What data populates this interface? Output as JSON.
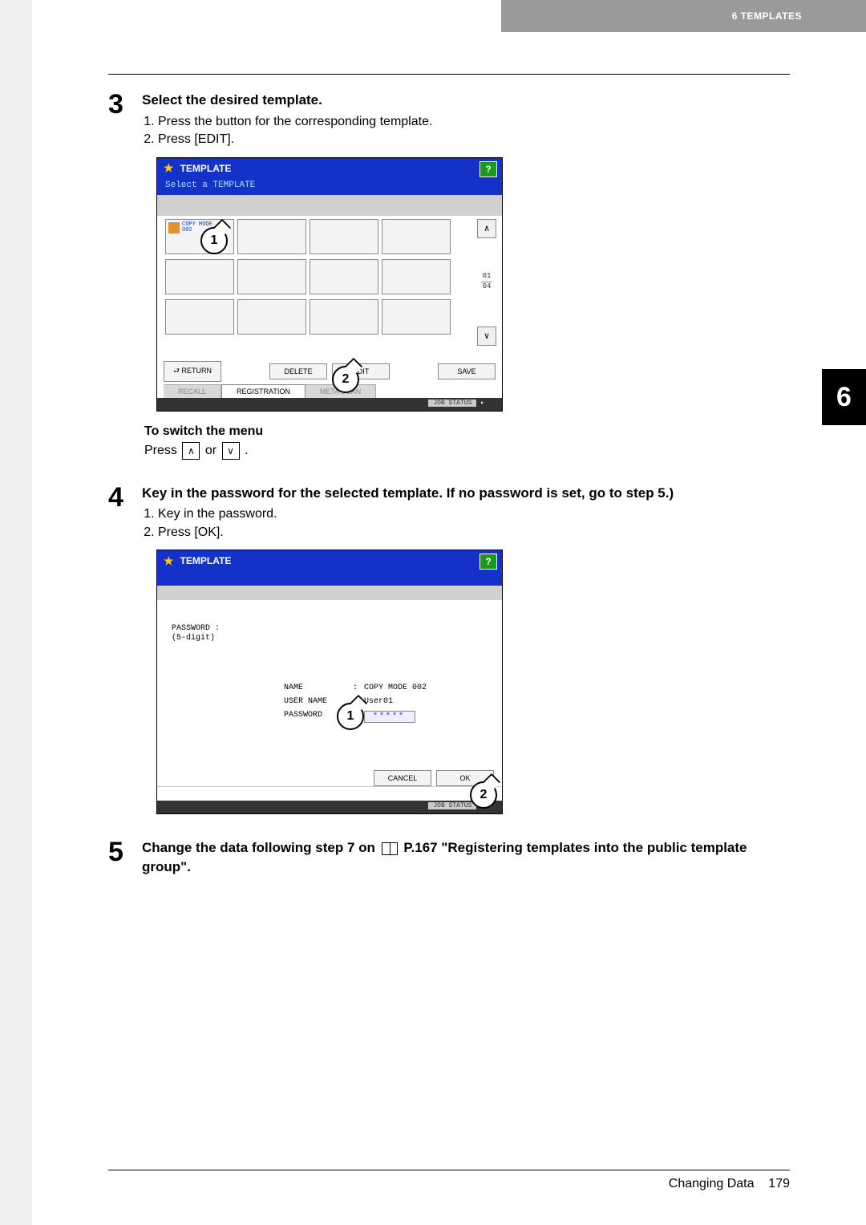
{
  "header": {
    "chapter_label": "6 TEMPLATES"
  },
  "side_tab": {
    "number": "6"
  },
  "step3": {
    "num": "3",
    "title": "Select the desired template.",
    "items": [
      "Press the button for the corresponding template.",
      "Press [EDIT]."
    ],
    "note_title": "To switch the menu",
    "note_prefix": "Press",
    "note_or": "or",
    "note_period": "."
  },
  "screenshot1": {
    "title": "TEMPLATE",
    "subtitle": "Select a TEMPLATE",
    "help": "?",
    "template_btn_line1": "COPY MODE",
    "template_btn_line2": "002",
    "scroll_up": "∧",
    "scroll_down": "∨",
    "page_current": "01",
    "page_total": "04",
    "return_btn": "⮐ RETURN",
    "delete_btn": "DELETE",
    "edit_btn": "EDIT",
    "save_btn": "SAVE",
    "tab_recall": "RECALL",
    "tab_registration": "REGISTRATION",
    "tab_meta": "META SCAN",
    "status": "JOB STATUS",
    "callout1": "1",
    "callout2": "2"
  },
  "step4": {
    "num": "4",
    "title": "Key in the password for the selected template. If no password is set, go to step 5.)",
    "items": [
      "Key in the password.",
      "Press [OK]."
    ]
  },
  "screenshot2": {
    "title": "TEMPLATE",
    "help": "?",
    "pw_label_l1": "PASSWORD :",
    "pw_label_l2": "(5-digit)",
    "name_key": "NAME",
    "name_val": "COPY MODE 002",
    "user_key": "USER NAME",
    "user_val": "User01",
    "pw_key": "PASSWORD",
    "pw_val": "*****",
    "cancel_btn": "CANCEL",
    "ok_btn": "OK",
    "status": "JOB STATUS",
    "callout1": "1",
    "callout2": "2"
  },
  "step5": {
    "num": "5",
    "title_a": "Change the data following step 7 on",
    "title_ref": "P.167 \"Registering templates into the public template group\".",
    "title_b": ""
  },
  "footer": {
    "section": "Changing Data",
    "page": "179"
  }
}
